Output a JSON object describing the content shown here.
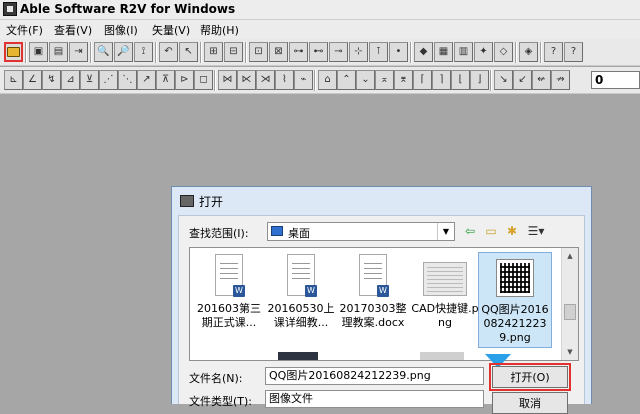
{
  "app": {
    "title": "Able Software R2V for Windows"
  },
  "menu": [
    "文件(F)",
    "查看(V)",
    "图像(I)",
    "矢量(V)",
    "帮助(H)"
  ],
  "toolbar1": {
    "icons": [
      "open-icon",
      "save-icon",
      "save-as-icon",
      "export-icon",
      "zoom-in-icon",
      "zoom-out-icon",
      "crop-icon",
      "undo-icon",
      "pointer-icon",
      "fit-icon",
      "raster-icon",
      "frame-icon",
      "frame-expand-icon",
      "node-link-icon",
      "node-center-icon",
      "node-end-icon",
      "line-end-icon",
      "line-node-icon",
      "point-icon",
      "diamond-icon",
      "grid-a-icon",
      "grid-b-icon",
      "star-icon",
      "vector-a-icon",
      "vector-b-icon",
      "help-icon",
      "about-icon"
    ],
    "glyphs": [
      "",
      "▣",
      "▤",
      "⇥",
      "🔍",
      "🔎",
      "⟟",
      "↶",
      "↖",
      "⊞",
      "⊟",
      "⊡",
      "⊠",
      "⊶",
      "⊷",
      "⊸",
      "⊹",
      "⊺",
      "•",
      "◆",
      "▦",
      "▥",
      "✦",
      "◇",
      "◈",
      "?",
      "?"
    ]
  },
  "toolbar2": {
    "glyphs": [
      "⊾",
      "∠",
      "↯",
      "⊿",
      "⊻",
      "⋰",
      "⋱",
      "↗",
      "⊼",
      "⊳",
      "◻",
      "⋈",
      "⋉",
      "⋊",
      "⌇",
      "⌁",
      "⌂",
      "⌃",
      "⌄",
      "⌅",
      "⌆",
      "⌈",
      "⌉",
      "⌊",
      "⌋",
      "↘",
      "↙",
      "↚",
      "↛",
      "↜",
      "↝"
    ],
    "coord_value": "0"
  },
  "dialog": {
    "title": "打开",
    "look_in_label": "查找范围(I):",
    "look_in_value": "桌面",
    "files": [
      {
        "name": "201603第三期正式课...",
        "kind": "docx"
      },
      {
        "name": "20160530上课详细教...",
        "kind": "docx"
      },
      {
        "name": "20170303整理教案.docx",
        "kind": "docx"
      },
      {
        "name": "CAD快捷键.png",
        "kind": "png"
      },
      {
        "name": "QQ图片20160824212239.png",
        "kind": "qr",
        "selected": true
      }
    ],
    "filename_label": "文件名(N):",
    "filename_value": "QQ图片20160824212239.png",
    "filetype_label": "文件类型(T):",
    "filetype_value": "图像文件",
    "open_button": "打开(O)",
    "cancel_button": "取消"
  }
}
